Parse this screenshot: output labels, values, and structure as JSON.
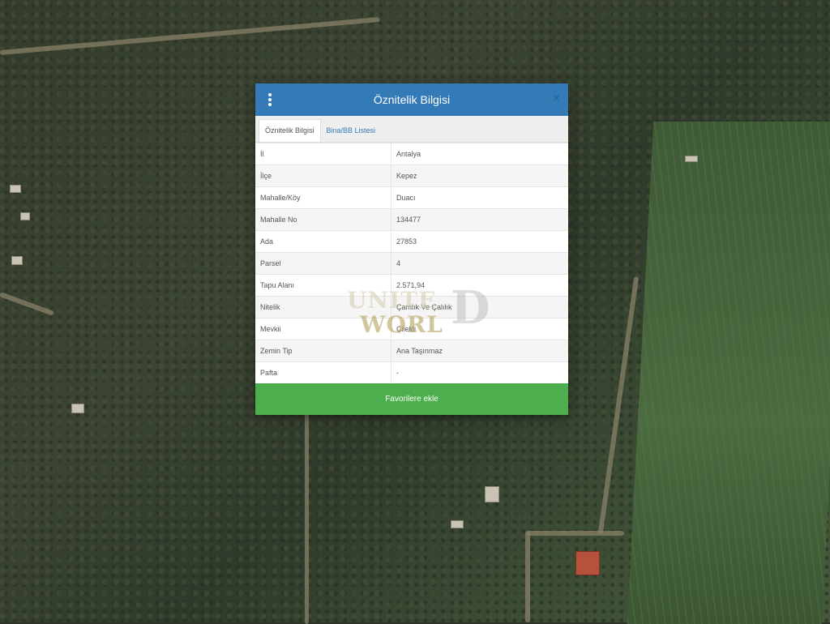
{
  "dialog": {
    "title": "Öznitelik Bilgisi",
    "close_glyph": "×",
    "tabs": [
      {
        "label": "Öznitelik Bilgisi",
        "active": true
      },
      {
        "label": "Bina/BB Listesi",
        "active": false
      }
    ],
    "rows": [
      {
        "key": "İl",
        "value": "Antalya"
      },
      {
        "key": "İlçe",
        "value": "Kepez"
      },
      {
        "key": "Mahalle/Köy",
        "value": "Duacı"
      },
      {
        "key": "Mahalle No",
        "value": "134477"
      },
      {
        "key": "Ada",
        "value": "27853"
      },
      {
        "key": "Parsel",
        "value": "4"
      },
      {
        "key": "Tapu Alanı",
        "value": "2.571,94"
      },
      {
        "key": "Nitelik",
        "value": "Çamlık Ve Çalılık"
      },
      {
        "key": "Mevkii",
        "value": "Çilekli"
      },
      {
        "key": "Zemin Tip",
        "value": "Ana Taşınmaz"
      },
      {
        "key": "Pafta",
        "value": "-"
      }
    ],
    "favorite_button": "Favorilere ekle"
  },
  "watermark": {
    "line1": "UNITE",
    "line2": "WORL",
    "big": "D"
  },
  "colors": {
    "header": "#337ab7",
    "button": "#4cae4c"
  }
}
